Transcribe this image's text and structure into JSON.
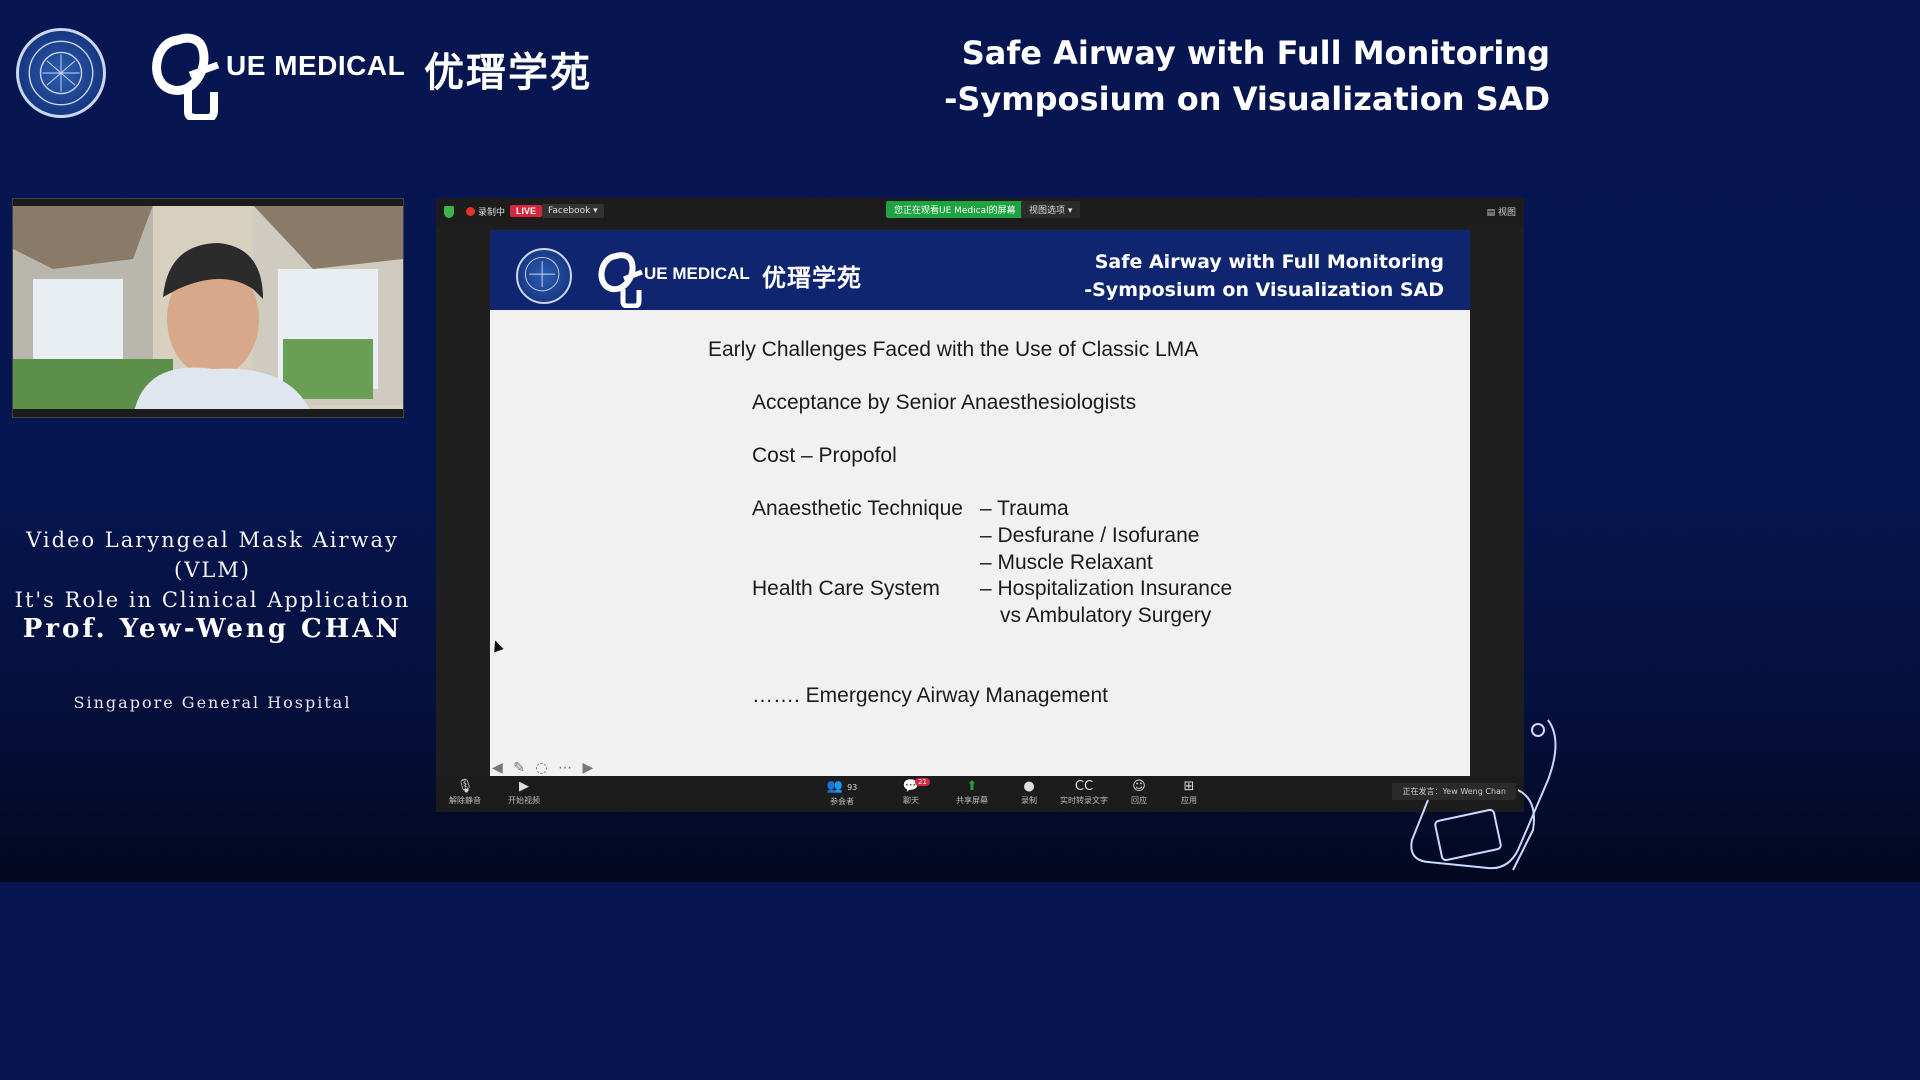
{
  "header": {
    "brand": "UE MEDICAL",
    "cn_brand": "优瑨学苑",
    "title_line1": "Safe Airway with Full Monitoring",
    "title_line2": "-Symposium on Visualization SAD"
  },
  "left_panel": {
    "talk_line1": "Video Laryngeal Mask Airway (VLM)",
    "talk_line2": "It's Role in Clinical Application",
    "speaker": "Prof. Yew-Weng CHAN",
    "affiliation": "Singapore General Hospital"
  },
  "zoom": {
    "top_bar": {
      "recording": "录制中",
      "live": "LIVE",
      "stream_target": "Facebook ▾",
      "viewing_notice": "您正在观看UE Medical的屏幕",
      "view_options": "视图选项 ▾",
      "right_label": "▤ 视图"
    },
    "slide": {
      "brand": "UE MEDICAL",
      "cn_brand": "优瑨学苑",
      "title_line1": "Safe Airway with Full Monitoring",
      "title_line2": "-Symposium on Visualization SAD",
      "heading": "Early Challenges Faced with the Use of Classic LMA",
      "item1": "Acceptance by Senior Anaesthesiologists",
      "item2": "Cost – Propofol",
      "item3_label": "Anaesthetic Technique",
      "item3_sub1": "– Trauma",
      "item3_sub2": "– Desfurane / Isofurane",
      "item3_sub3": "– Muscle Relaxant",
      "item4_label": "Health Care System",
      "item4_sub1": "– Hospitalization Insurance",
      "item4_sub2": "vs Ambulatory Surgery",
      "item5": "……. Emergency Airway Management"
    },
    "toolbar": {
      "unmute": "解除静音",
      "start_video": "开始视频",
      "participants": "参会者",
      "participants_count": "93",
      "chat": "聊天",
      "chat_badge": "21",
      "share_screen": "共享屏幕",
      "record": "录制",
      "live_transcript": "实时转录文字",
      "reactions": "回应",
      "apps": "应用",
      "speaking_now": "正在发言：Yew Weng Chan"
    }
  }
}
